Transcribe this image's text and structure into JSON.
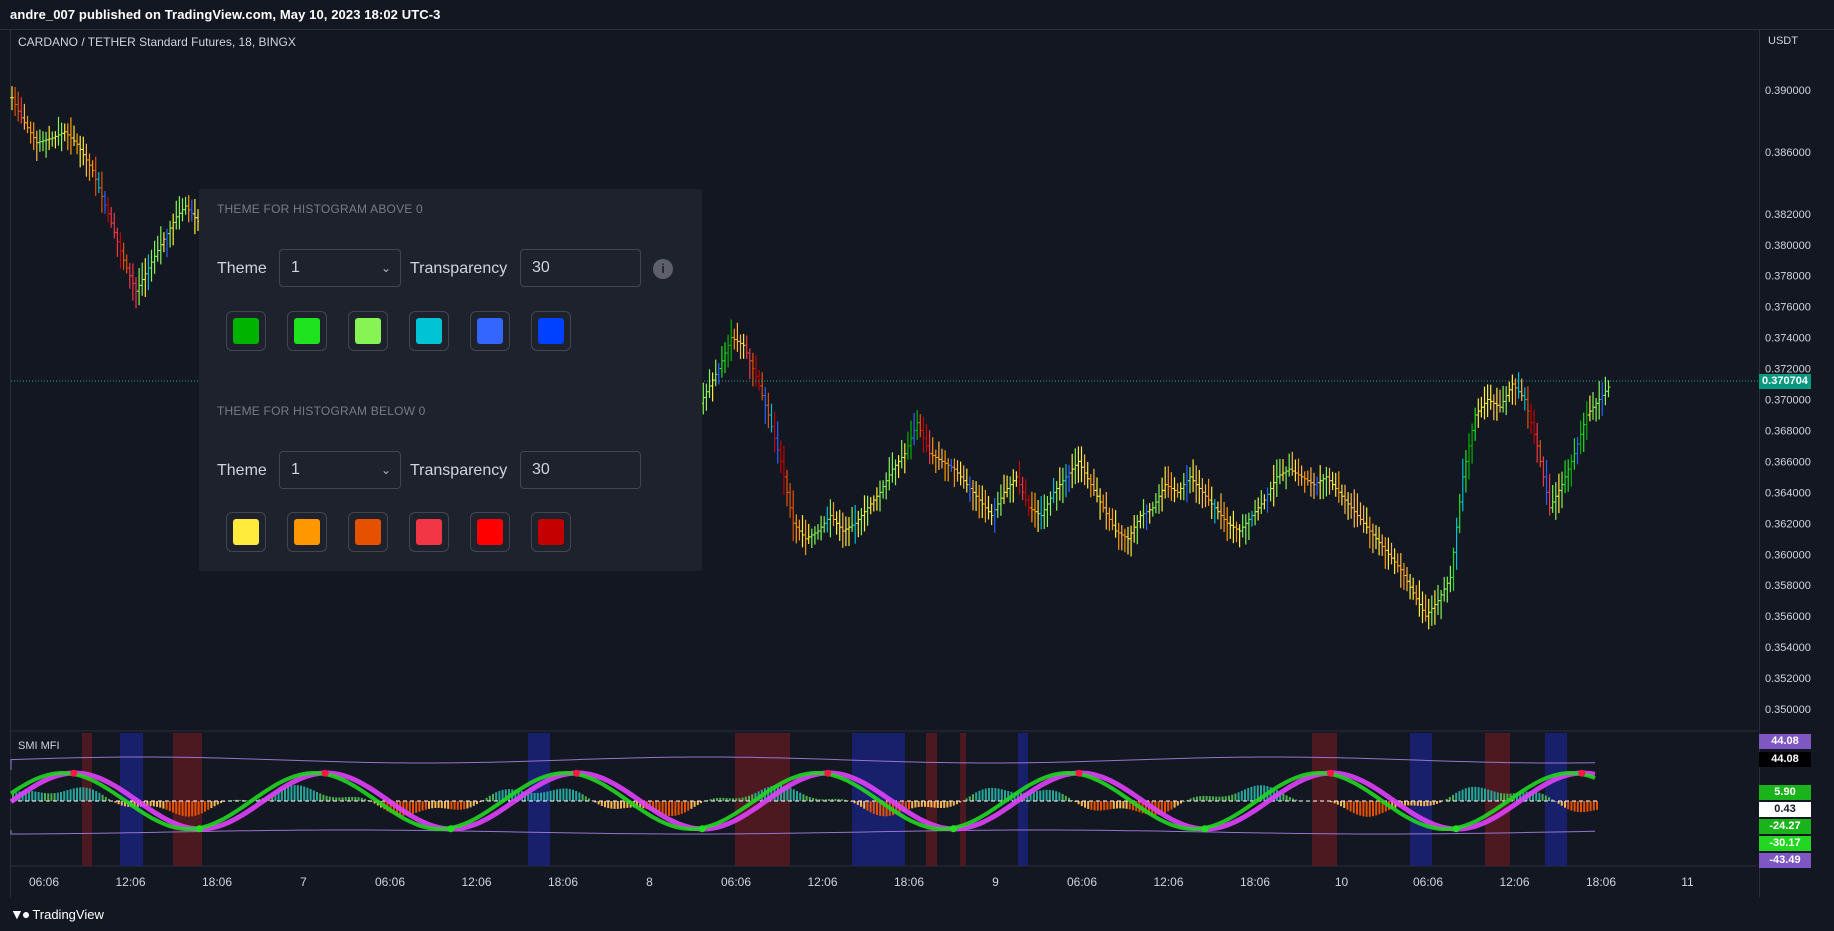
{
  "header": {
    "published": "andre_007 published on TradingView.com, May 10, 2023 18:02 UTC-3"
  },
  "chart": {
    "title": "CARDANO / TETHER Standard Futures, 18, BINGX",
    "unit": "USDT",
    "price_ticks": [
      "0.390000",
      "0.386000",
      "0.382000",
      "0.380000",
      "0.378000",
      "0.376000",
      "0.374000",
      "0.372000",
      "0.370000",
      "0.368000",
      "0.366000",
      "0.364000",
      "0.362000",
      "0.360000",
      "0.358000",
      "0.356000",
      "0.354000",
      "0.352000",
      "0.350000"
    ],
    "last_price": "0.370704",
    "time_ticks": [
      "06:06",
      "12:06",
      "18:06",
      "7",
      "06:06",
      "12:06",
      "18:06",
      "8",
      "06:06",
      "12:06",
      "18:06",
      "9",
      "06:06",
      "12:06",
      "18:06",
      "10",
      "06:06",
      "12:06",
      "18:06",
      "11"
    ]
  },
  "chart_data": {
    "type": "candlestick",
    "title": "CARDANO / TETHER Standard Futures, 18, BINGX",
    "ylim": [
      0.349,
      0.392
    ],
    "x_ticks": [
      "06:06",
      "12:06",
      "18:06",
      "7",
      "06:06",
      "12:06",
      "18:06",
      "8",
      "06:06",
      "12:06",
      "18:06",
      "9",
      "06:06",
      "12:06",
      "18:06",
      "10",
      "06:06",
      "12:06",
      "18:06",
      "11"
    ],
    "y_ticks": [
      0.39,
      0.386,
      0.382,
      0.38,
      0.378,
      0.376,
      0.374,
      0.372,
      0.37,
      0.368,
      0.366,
      0.364,
      0.362,
      0.36,
      0.358,
      0.356,
      0.354,
      0.352,
      0.35
    ],
    "close_path": [
      [
        0,
        0.3895
      ],
      [
        3,
        0.3882
      ],
      [
        8,
        0.3866
      ],
      [
        13,
        0.3869
      ],
      [
        17,
        0.3873
      ],
      [
        21,
        0.3865
      ],
      [
        26,
        0.3848
      ],
      [
        31,
        0.382
      ],
      [
        36,
        0.379
      ],
      [
        40,
        0.377
      ],
      [
        44,
        0.3785
      ],
      [
        48,
        0.38
      ],
      [
        53,
        0.3818
      ],
      [
        56,
        0.3825
      ],
      [
        60,
        0.3815
      ],
      [
        190,
        0.38
      ],
      [
        194,
        0.369
      ],
      [
        197,
        0.367
      ],
      [
        200,
        0.3645
      ],
      [
        204,
        0.3658
      ],
      [
        208,
        0.3668
      ],
      [
        212,
        0.3685
      ],
      [
        216,
        0.3695
      ],
      [
        220,
        0.369
      ],
      [
        224,
        0.3705
      ],
      [
        228,
        0.372
      ],
      [
        232,
        0.374
      ],
      [
        236,
        0.3735
      ],
      [
        240,
        0.3715
      ],
      [
        244,
        0.369
      ],
      [
        248,
        0.366
      ],
      [
        252,
        0.362
      ],
      [
        256,
        0.361
      ],
      [
        260,
        0.3615
      ],
      [
        264,
        0.3625
      ],
      [
        268,
        0.3615
      ],
      [
        272,
        0.362
      ],
      [
        276,
        0.363
      ],
      [
        280,
        0.364
      ],
      [
        284,
        0.3655
      ],
      [
        288,
        0.3665
      ],
      [
        292,
        0.3685
      ],
      [
        296,
        0.3665
      ],
      [
        300,
        0.366
      ],
      [
        304,
        0.3655
      ],
      [
        308,
        0.3645
      ],
      [
        312,
        0.3635
      ],
      [
        316,
        0.3625
      ],
      [
        320,
        0.364
      ],
      [
        324,
        0.365
      ],
      [
        328,
        0.363
      ],
      [
        332,
        0.3625
      ],
      [
        336,
        0.364
      ],
      [
        340,
        0.365
      ],
      [
        344,
        0.366
      ],
      [
        348,
        0.3645
      ],
      [
        352,
        0.363
      ],
      [
        356,
        0.3615
      ],
      [
        360,
        0.361
      ],
      [
        364,
        0.3625
      ],
      [
        368,
        0.363
      ],
      [
        372,
        0.3645
      ],
      [
        376,
        0.364
      ],
      [
        380,
        0.365
      ],
      [
        384,
        0.364
      ],
      [
        388,
        0.363
      ],
      [
        392,
        0.362
      ],
      [
        396,
        0.3615
      ],
      [
        400,
        0.3625
      ],
      [
        404,
        0.3635
      ],
      [
        408,
        0.365
      ],
      [
        412,
        0.3655
      ],
      [
        416,
        0.365
      ],
      [
        420,
        0.3645
      ],
      [
        424,
        0.365
      ],
      [
        428,
        0.364
      ],
      [
        432,
        0.363
      ],
      [
        436,
        0.362
      ],
      [
        440,
        0.361
      ],
      [
        444,
        0.36
      ],
      [
        448,
        0.359
      ],
      [
        452,
        0.3575
      ],
      [
        456,
        0.356
      ],
      [
        460,
        0.357
      ],
      [
        464,
        0.3585
      ],
      [
        468,
        0.365
      ],
      [
        472,
        0.369
      ],
      [
        476,
        0.37
      ],
      [
        480,
        0.3695
      ],
      [
        484,
        0.371
      ],
      [
        488,
        0.37
      ],
      [
        492,
        0.367
      ],
      [
        496,
        0.363
      ],
      [
        500,
        0.3645
      ],
      [
        504,
        0.3665
      ],
      [
        508,
        0.369
      ],
      [
        512,
        0.37
      ],
      [
        515,
        0.3708
      ]
    ],
    "indicator": {
      "name": "SMI MFI",
      "value_labels": [
        "44.08",
        "44.08",
        "5.90",
        "0.43",
        "-24.27",
        "-30.17",
        "-43.49"
      ]
    }
  },
  "settings_panel": {
    "above": {
      "section_label": "THEME FOR HISTOGRAM ABOVE 0",
      "theme_label": "Theme",
      "theme_value": "1",
      "transparency_label": "Transparency",
      "transparency_value": "30",
      "swatches": [
        "#00b300",
        "#1ee31e",
        "#86f553",
        "#00c4d6",
        "#3366ff",
        "#0040ff"
      ]
    },
    "below": {
      "section_label": "THEME FOR HISTOGRAM BELOW 0",
      "theme_label": "Theme",
      "theme_value": "1",
      "transparency_label": "Transparency",
      "transparency_value": "30",
      "swatches": [
        "#ffeb3b",
        "#ff9800",
        "#e65100",
        "#f23645",
        "#ff0000",
        "#c40000"
      ]
    }
  },
  "footer": {
    "brand": "TradingView"
  },
  "colors": {
    "background": "#131722",
    "panel": "#1e222d",
    "last_price": "#089981",
    "grid": "#2a2e39"
  }
}
